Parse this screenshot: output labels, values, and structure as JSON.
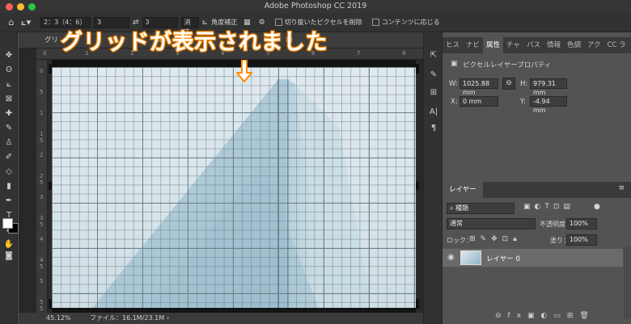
{
  "window": {
    "title": "Adobe Photoshop CC 2019"
  },
  "options_bar": {
    "ratio": "2：3（4：6）",
    "width_value": "3",
    "height_value": "3",
    "clear_label": "消去",
    "straighten_label": "角度補正",
    "delete_cropped_label": "切り抜いたピクセルを削除",
    "content_aware_label": "コンテンツに応じる"
  },
  "document": {
    "tab_label": "グリ",
    "tab_label_tail": "sd",
    "tab_label_end": "8)",
    "ruler_h": [
      "0",
      "1",
      "2",
      "3",
      "4",
      "5",
      "6",
      "7",
      "8"
    ],
    "ruler_v": [
      "0",
      "5",
      "1",
      "1 5",
      "2",
      "2 5",
      "3",
      "3 5",
      "4",
      "4 5",
      "5",
      "5 5"
    ]
  },
  "annotation": {
    "text": "グリッドが表示されました"
  },
  "status_bar": {
    "zoom": "45.12%",
    "file_info": "ファイル：16.1M/23.1M"
  },
  "properties_panel": {
    "tabs": [
      "ヒス",
      "ナビ",
      "属性",
      "チャ",
      "パス",
      "情報",
      "色調",
      "アク",
      "CC ラ"
    ],
    "active_tab": "属性",
    "header": "ピクセルレイヤープロパティ",
    "w_label": "W:",
    "w_value": "1025.88 mm",
    "h_label": "H:",
    "h_value": "979.31 mm",
    "x_label": "X:",
    "x_value": "0 mm",
    "y_label": "Y:",
    "y_value": "-4.94 mm"
  },
  "layers_panel": {
    "tab": "レイヤー",
    "filter": "種類",
    "blend_mode": "通常",
    "opacity_label": "不透明度：",
    "opacity_value": "100%",
    "lock_label": "ロック：",
    "fill_label": "塗り：",
    "fill_value": "100%",
    "layers": [
      {
        "name": "レイヤー 0",
        "visible": true
      }
    ]
  },
  "colors": {
    "accent_annotation": "#ff8c00",
    "panel_bg": "#535353",
    "doc_bg": "#282828"
  }
}
